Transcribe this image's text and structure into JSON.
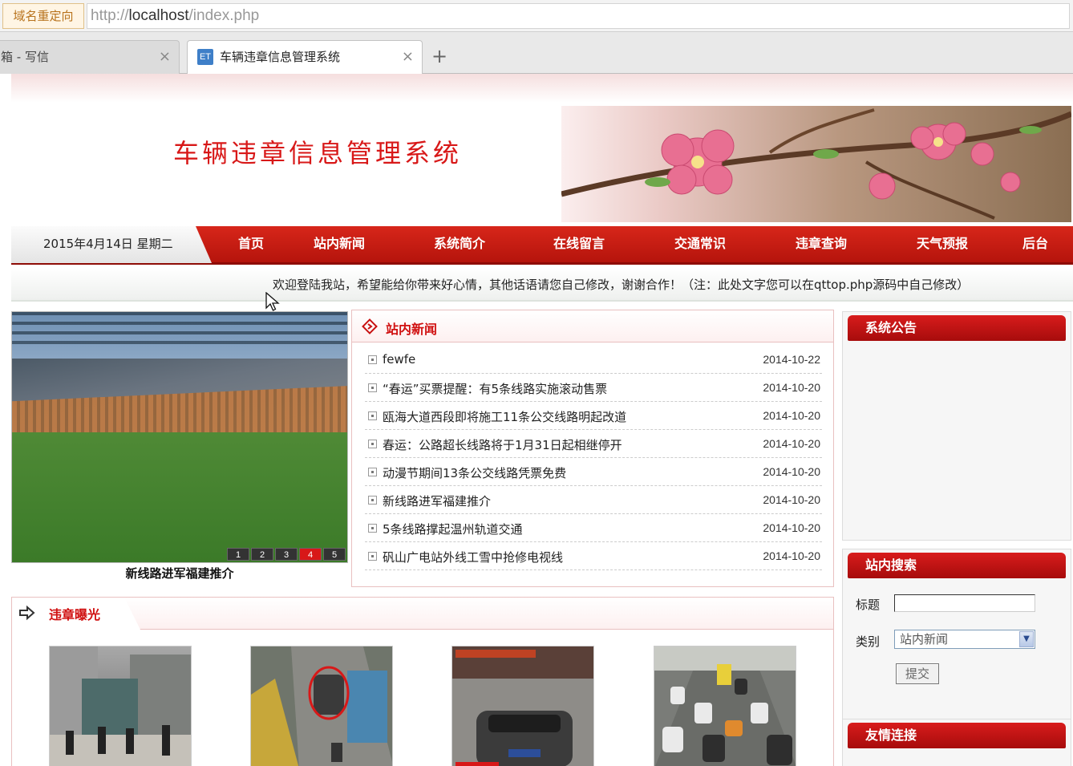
{
  "browser": {
    "redirect_badge": "域名重定向",
    "url_prefix": "http://",
    "url_host": "localhost",
    "url_path": "/index.php",
    "tabs": [
      {
        "label": "箱 - 写信",
        "close": "×"
      },
      {
        "label": "车辆违章信息管理系统",
        "close": "×"
      }
    ],
    "new_tab": "+"
  },
  "site": {
    "title": "车辆违章信息管理系统",
    "date_text": "2015年4月14日 星期二",
    "nav": [
      "首页",
      "站内新闻",
      "系统简介",
      "在线留言",
      "交通常识",
      "违章查询",
      "天气预报",
      "后台"
    ],
    "marquee": "欢迎登陆我站，希望能给你带来好心情，其他话语请您自己修改，谢谢合作！（注：此处文字您可以在qttop.php源码中自己修改）"
  },
  "slideshow": {
    "numbers": [
      "1",
      "2",
      "3",
      "4",
      "5"
    ],
    "active": 4,
    "caption": "新线路进军福建推介"
  },
  "news": {
    "title": "站内新闻",
    "items": [
      {
        "title": "fewfe",
        "date": "2014-10-22"
      },
      {
        "title": "“春运”买票提醒：有5条线路实施滚动售票",
        "date": "2014-10-20"
      },
      {
        "title": "瓯海大道西段即将施工11条公交线路明起改道",
        "date": "2014-10-20"
      },
      {
        "title": "春运：公路超长线路将于1月31日起相继停开",
        "date": "2014-10-20"
      },
      {
        "title": "动漫节期间13条公交线路凭票免费",
        "date": "2014-10-20"
      },
      {
        "title": "新线路进军福建推介",
        "date": "2014-10-20"
      },
      {
        "title": "5条线路撑起温州轨道交通",
        "date": "2014-10-20"
      },
      {
        "title": "矾山广电站外线工雪中抢修电视线",
        "date": "2014-10-20"
      }
    ]
  },
  "violations": {
    "title": "违章曝光"
  },
  "sidebar": {
    "notice_title": "系统公告",
    "search_title": "站内搜索",
    "label_title": "标题",
    "label_category": "类别",
    "category_value": "站内新闻",
    "submit_label": "提交",
    "links_title": "友情连接"
  },
  "colors": {
    "brand_red": "#d81818",
    "nav_red": "#c21a10"
  }
}
